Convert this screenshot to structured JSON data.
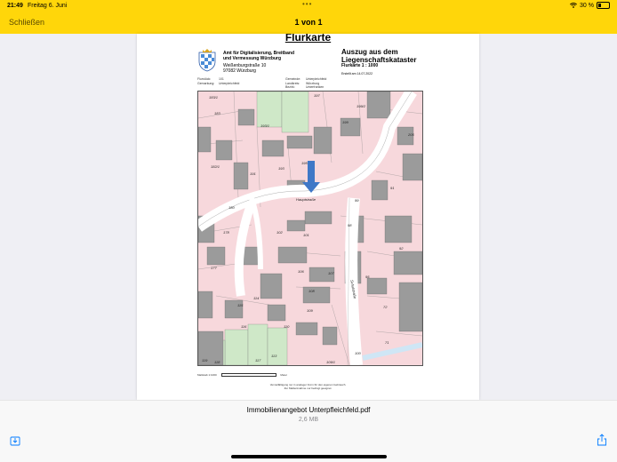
{
  "status": {
    "time": "21:49",
    "date": "Freitag 6. Juni",
    "dots": "•••",
    "battery": "30 %",
    "battery_level": 0.3
  },
  "nav": {
    "close_label": "Schließen",
    "page_counter": "1 von 1"
  },
  "document": {
    "title": "Flurkarte",
    "office": "Amt für Digitalisierung, Breitband und Vermessung Würzburg",
    "street": "Weißenburgstraße 10",
    "city": "97082 Würzburg",
    "extract_line1": "Auszug aus dem",
    "extract_line2": "Liegenschaftskataster",
    "scale": "Flurkarte 1 : 1000",
    "created": "Erstellt am 14.07.2022",
    "meta_left": [
      "Flurstück:",
      "Gemarkung:"
    ],
    "meta_left_values": [
      "101",
      "Unterpleichfeld"
    ],
    "meta_right": [
      "Gemeinde:",
      "Landkreis:",
      "Bezirk:"
    ],
    "meta_right_values": [
      "Unterpleichfeld",
      "Würzburg",
      "Unterfranken"
    ],
    "street_labels": [
      "Hauptstraße",
      "Schulstraße"
    ],
    "parcels": [
      "183/1",
      "183",
      "193/1",
      "197",
      "199/2",
      "199",
      "205",
      "182/1",
      "191",
      "193",
      "195",
      "91",
      "99",
      "180",
      "98",
      "102",
      "101",
      "178",
      "92",
      "177",
      "106",
      "107",
      "95",
      "114",
      "108",
      "72",
      "115",
      "109",
      "116",
      "110",
      "71",
      "100",
      "119",
      "118",
      "117",
      "113",
      "109/1"
    ],
    "footer_scale": "Maßstab 1:1000",
    "footer_unit": "Meter",
    "footer_note_1": "Vervielfältigung nur in analoger Form für den eigenen Gebrauch.",
    "footer_note_2": "Zur Maßentnahme nur bedingt geeignet."
  },
  "file": {
    "name": "Immobilienangebot Unterpfleichfeld.pdf",
    "size": "2,6 MB"
  },
  "colors": {
    "accent": "#ffd60a",
    "parcel_pink": "#f7d8dc",
    "building": "#9b9b9b",
    "street": "#ffffff",
    "green": "#cfe8c8",
    "arrow": "#3f78c7"
  },
  "icons": [
    "wifi-icon",
    "battery-icon",
    "download-icon",
    "share-icon",
    "bavarian-crest-icon",
    "location-arrow-icon"
  ]
}
